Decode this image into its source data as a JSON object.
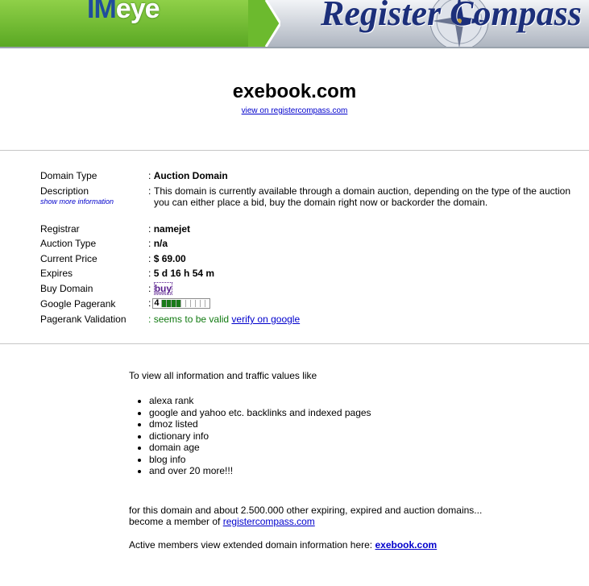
{
  "banner": {
    "logo_im": "IM",
    "logo_eye": "eye",
    "brand_title": "Register Compass"
  },
  "header": {
    "domain": "exebook.com",
    "view_link": "view on registercompass.com"
  },
  "details": {
    "domain_type": {
      "label": "Domain Type",
      "value": "Auction Domain"
    },
    "description": {
      "label": "Description",
      "more_link": "show more information",
      "value": "This domain is currently available through a domain auction, depending on the type of the auction you can either place a bid, buy the domain right now or backorder the domain."
    },
    "registrar": {
      "label": "Registrar",
      "value": "namejet"
    },
    "auction_type": {
      "label": "Auction Type",
      "value": "n/a"
    },
    "current_price": {
      "label": "Current Price",
      "value": "$ 69.00"
    },
    "expires": {
      "label": "Expires",
      "value": "5 d 16 h 54 m"
    },
    "buy_domain": {
      "label": "Buy Domain",
      "value": "buy"
    },
    "google_pagerank": {
      "label": "Google Pagerank",
      "value": "4",
      "max": 10
    },
    "pagerank_validation": {
      "label": "Pagerank Validation",
      "status": "seems to be valid",
      "verify_link": "verify on google"
    }
  },
  "separator": ":",
  "promo": {
    "intro": "To view all information and traffic values like",
    "features": [
      "alexa rank",
      "google and yahoo etc. backlinks and indexed pages",
      "dmoz listed",
      "dictionary info",
      "domain age",
      "blog info",
      "and over 20 more!!!"
    ],
    "line1": "for this domain and about 2.500.000 other expiring, expired and auction domains...",
    "line2_prefix": "become a member of",
    "member_link": "registercompass.com",
    "active_prefix": "Active members view extended domain information here:",
    "active_link": "exebook.com"
  },
  "colors": {
    "link": "#0000cc",
    "valid_green": "#117a11",
    "pagerank_fill": "#1a7a1a",
    "banner_green": "#6cba2e"
  }
}
